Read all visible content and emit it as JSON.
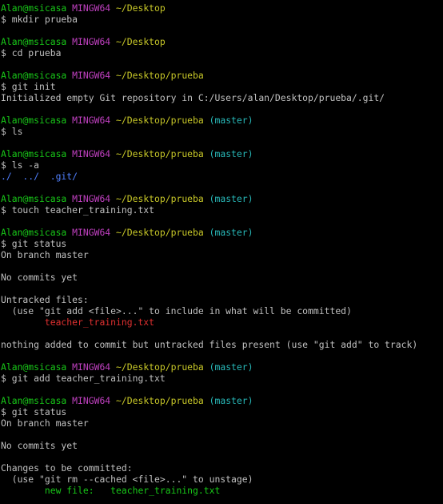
{
  "terminal": {
    "lines": [
      {
        "type": "prompt",
        "user": "Alan@msicasa",
        "host": "MINGW64",
        "path": "~/Desktop",
        "branch": ""
      },
      {
        "type": "cmd",
        "text": "$ mkdir prueba"
      },
      {
        "type": "blank"
      },
      {
        "type": "prompt",
        "user": "Alan@msicasa",
        "host": "MINGW64",
        "path": "~/Desktop",
        "branch": ""
      },
      {
        "type": "cmd",
        "text": "$ cd prueba"
      },
      {
        "type": "blank"
      },
      {
        "type": "prompt",
        "user": "Alan@msicasa",
        "host": "MINGW64",
        "path": "~/Desktop/prueba",
        "branch": ""
      },
      {
        "type": "cmd",
        "text": "$ git init"
      },
      {
        "type": "out",
        "text": "Initialized empty Git repository in C:/Users/alan/Desktop/prueba/.git/"
      },
      {
        "type": "blank"
      },
      {
        "type": "prompt",
        "user": "Alan@msicasa",
        "host": "MINGW64",
        "path": "~/Desktop/prueba",
        "branch": "(master)"
      },
      {
        "type": "cmd",
        "text": "$ ls"
      },
      {
        "type": "blank"
      },
      {
        "type": "prompt",
        "user": "Alan@msicasa",
        "host": "MINGW64",
        "path": "~/Desktop/prueba",
        "branch": "(master)"
      },
      {
        "type": "cmd",
        "text": "$ ls -a"
      },
      {
        "type": "dirs",
        "text": "./  ../  .git/"
      },
      {
        "type": "blank"
      },
      {
        "type": "prompt",
        "user": "Alan@msicasa",
        "host": "MINGW64",
        "path": "~/Desktop/prueba",
        "branch": "(master)"
      },
      {
        "type": "cmd",
        "text": "$ touch teacher_training.txt"
      },
      {
        "type": "blank"
      },
      {
        "type": "prompt",
        "user": "Alan@msicasa",
        "host": "MINGW64",
        "path": "~/Desktop/prueba",
        "branch": "(master)"
      },
      {
        "type": "cmd",
        "text": "$ git status"
      },
      {
        "type": "out",
        "text": "On branch master"
      },
      {
        "type": "blank"
      },
      {
        "type": "out",
        "text": "No commits yet"
      },
      {
        "type": "blank"
      },
      {
        "type": "out",
        "text": "Untracked files:"
      },
      {
        "type": "out",
        "text": "  (use \"git add <file>...\" to include in what will be committed)"
      },
      {
        "type": "red",
        "text": "        teacher_training.txt"
      },
      {
        "type": "blank"
      },
      {
        "type": "out",
        "text": "nothing added to commit but untracked files present (use \"git add\" to track)"
      },
      {
        "type": "blank"
      },
      {
        "type": "prompt",
        "user": "Alan@msicasa",
        "host": "MINGW64",
        "path": "~/Desktop/prueba",
        "branch": "(master)"
      },
      {
        "type": "cmd",
        "text": "$ git add teacher_training.txt"
      },
      {
        "type": "blank"
      },
      {
        "type": "prompt",
        "user": "Alan@msicasa",
        "host": "MINGW64",
        "path": "~/Desktop/prueba",
        "branch": "(master)"
      },
      {
        "type": "cmd",
        "text": "$ git status"
      },
      {
        "type": "out",
        "text": "On branch master"
      },
      {
        "type": "blank"
      },
      {
        "type": "out",
        "text": "No commits yet"
      },
      {
        "type": "blank"
      },
      {
        "type": "out",
        "text": "Changes to be committed:"
      },
      {
        "type": "out",
        "text": "  (use \"git rm --cached <file>...\" to unstage)"
      },
      {
        "type": "green",
        "text": "        new file:   teacher_training.txt"
      }
    ]
  },
  "colors": {
    "background": "#000000",
    "text": "#c0c0c0",
    "user": "#18c818",
    "host": "#c040c0",
    "path": "#c8c828",
    "branch": "#28b8b8",
    "untracked": "#e03030",
    "staged": "#18c818",
    "directory": "#5080ff"
  }
}
